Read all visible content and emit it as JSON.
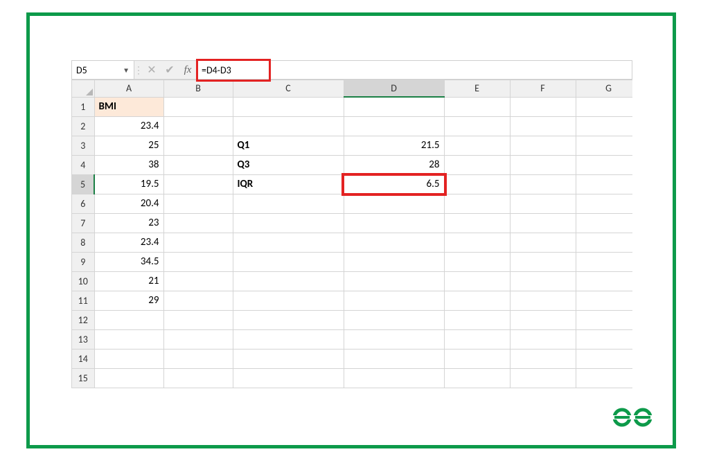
{
  "namebox": "D5",
  "formula": "=D4-D3",
  "columns": [
    "A",
    "B",
    "C",
    "D",
    "E",
    "F",
    "G"
  ],
  "rows": [
    "1",
    "2",
    "3",
    "4",
    "5",
    "6",
    "7",
    "8",
    "9",
    "10",
    "11",
    "12",
    "13",
    "14",
    "15"
  ],
  "cells": {
    "A1": "BMI",
    "A2": "23.4",
    "A3": "25",
    "A4": "38",
    "A5": "19.5",
    "A6": "20.4",
    "A7": "23",
    "A8": "23.4",
    "A9": "34.5",
    "A10": "21",
    "A11": "29",
    "C3": "Q1",
    "C4": "Q3",
    "C5": "IQR",
    "D3": "21.5",
    "D4": "28",
    "D5": "6.5"
  },
  "selectedCell": "D5",
  "logo": "ΘG"
}
